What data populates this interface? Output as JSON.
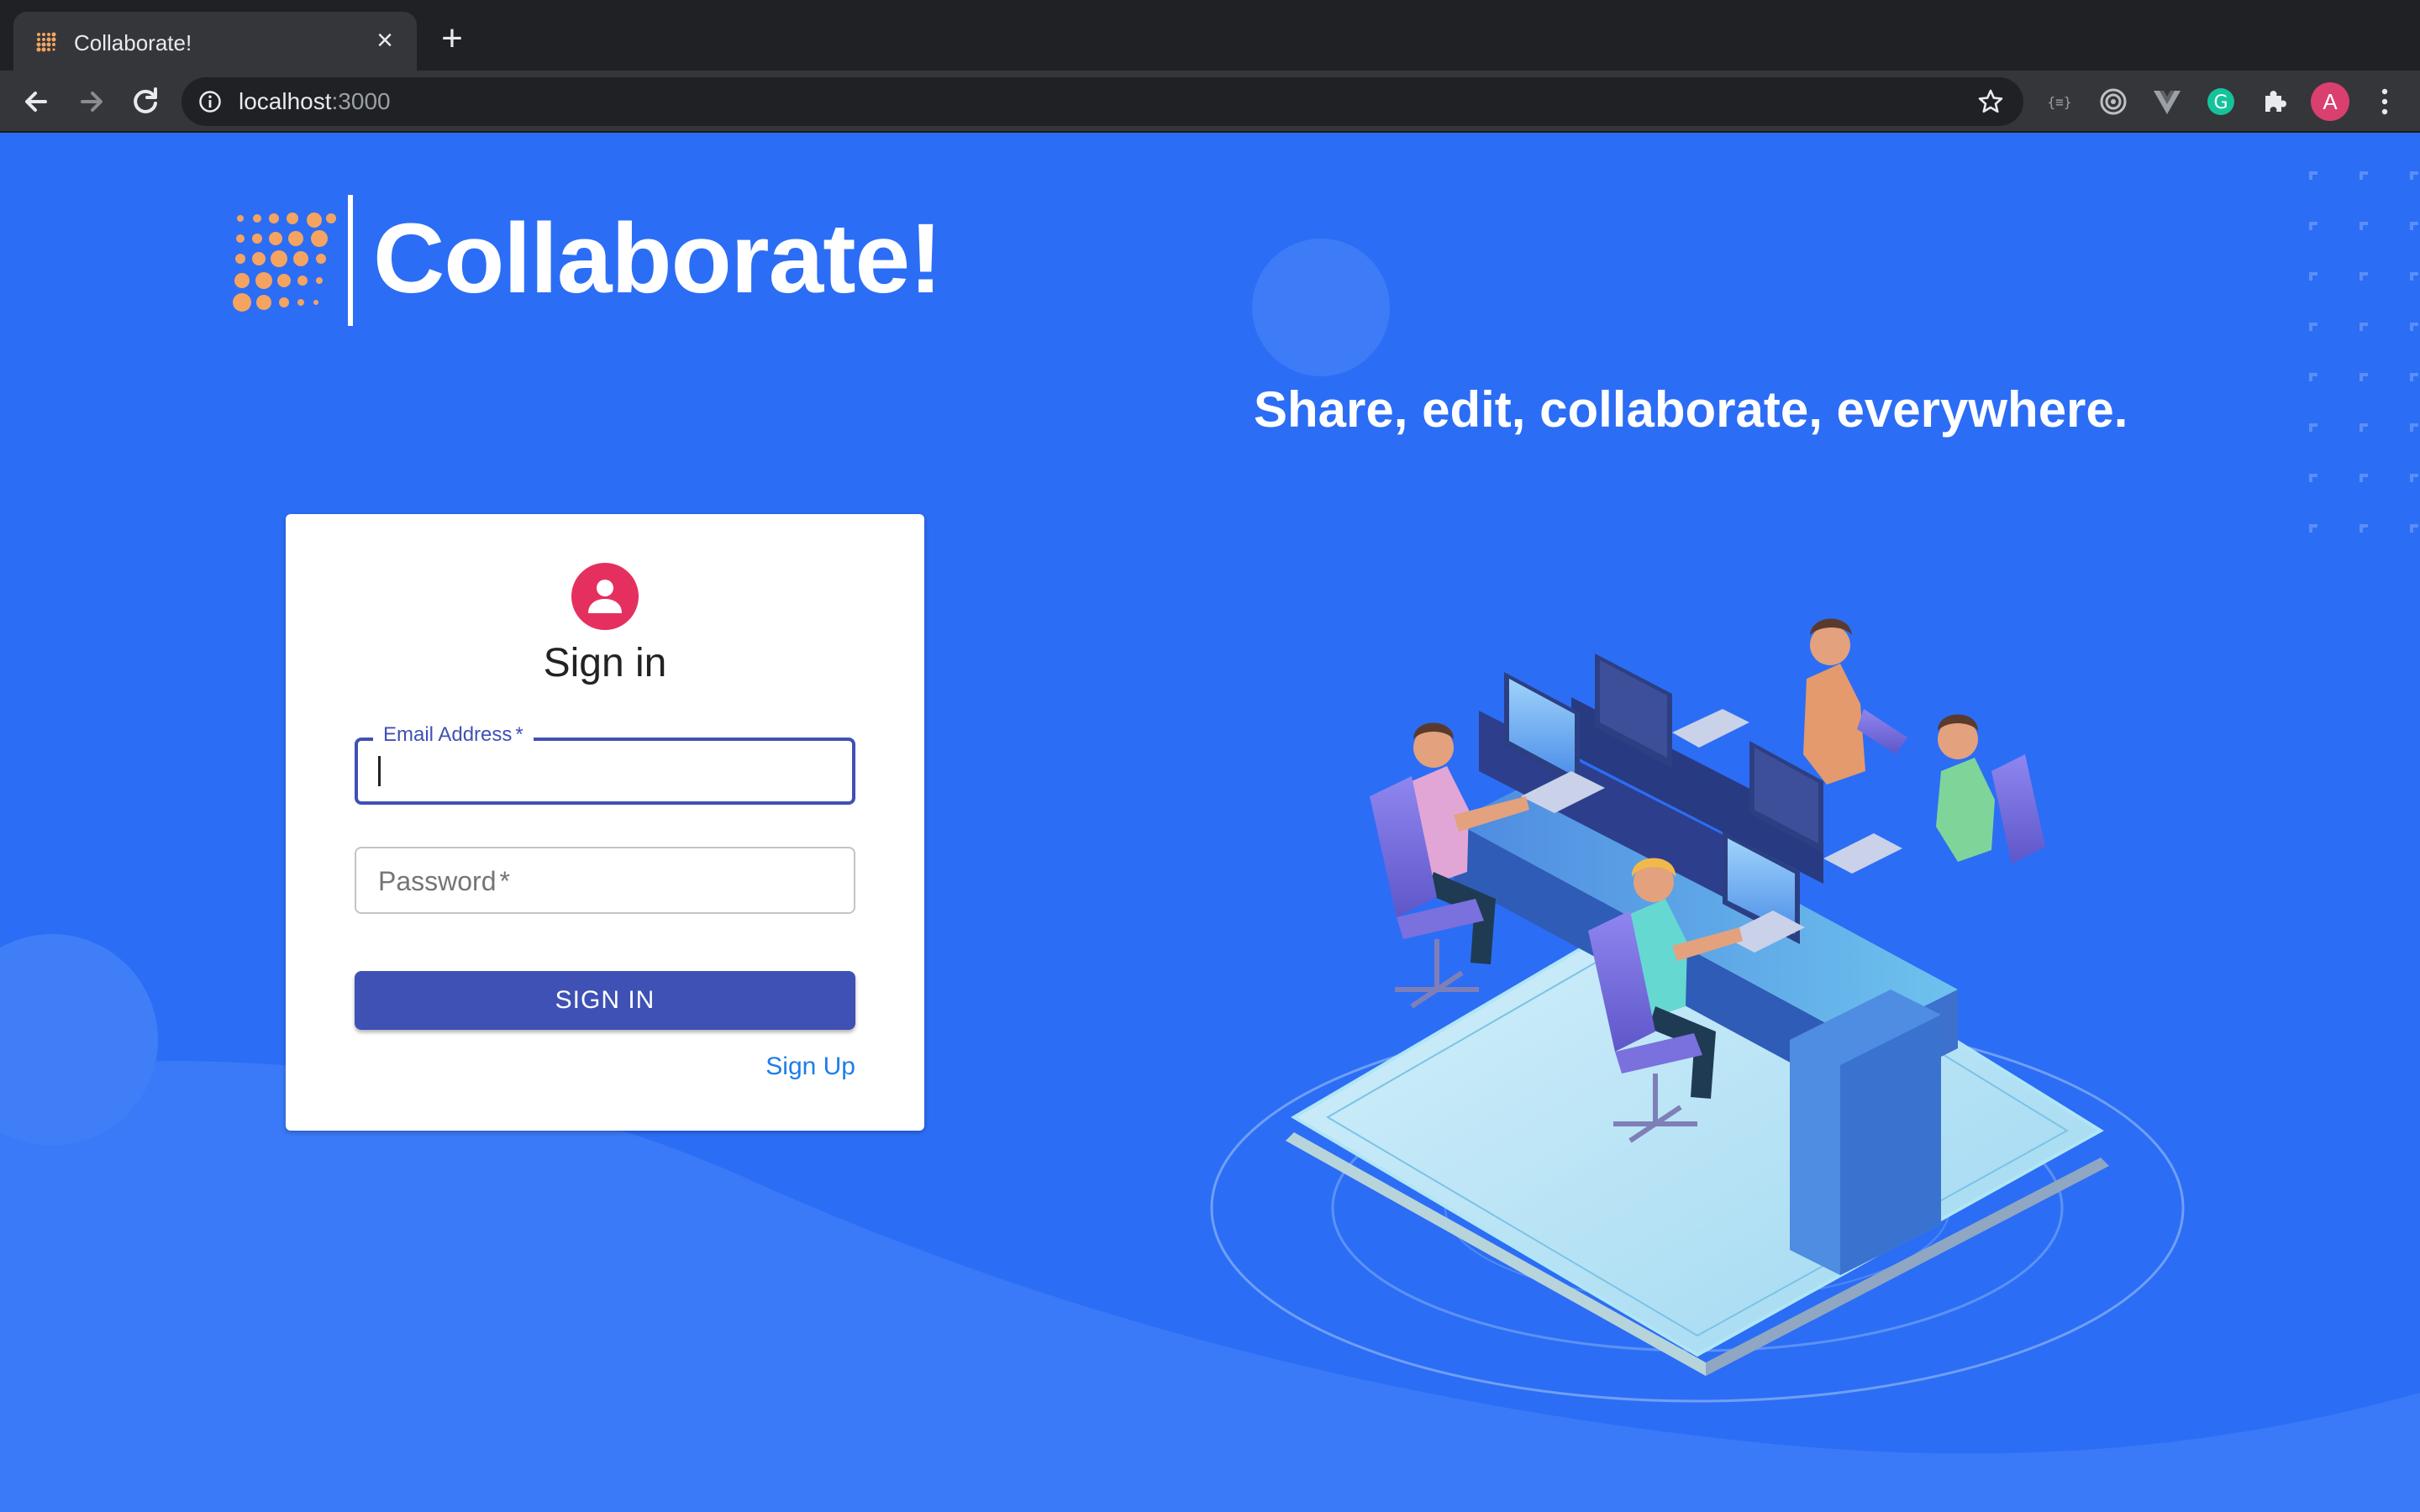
{
  "browser": {
    "tab_title": "Collaborate!",
    "tab_close": "×",
    "new_tab": "+",
    "url_host": "localhost",
    "url_port": ":3000",
    "profile_initial": "A",
    "extensions": [
      "json-viewer-icon",
      "target-icon",
      "vue-devtools-icon",
      "grammarly-icon",
      "puzzle-icon"
    ]
  },
  "brand": {
    "name": "Collaborate!",
    "logo_color": "#f4a460"
  },
  "hero": {
    "tagline": "Share, edit, collaborate, everywhere."
  },
  "signin": {
    "title": "Sign in",
    "email_label": "Email Address",
    "password_placeholder": "Password",
    "required_mark": "*",
    "button_label": "SIGN IN",
    "signup_link": "Sign Up"
  },
  "colors": {
    "background": "#2c6df5",
    "primary": "#3f51b5",
    "avatar": "#e5305f",
    "link": "#1f7de8"
  }
}
